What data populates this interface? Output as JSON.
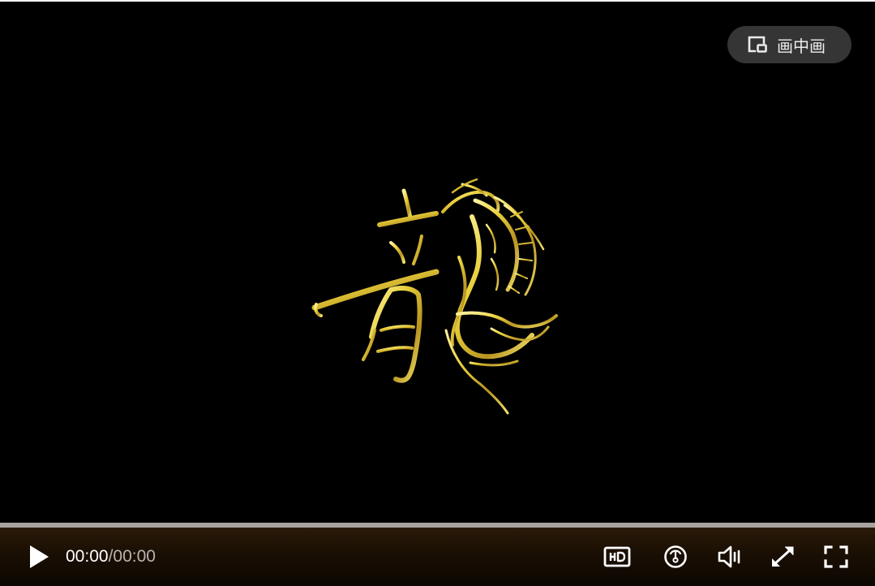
{
  "player": {
    "pip_button": {
      "label": "画中画",
      "icon": "picture-in-picture-icon"
    },
    "video_logo": {
      "description_icon": "dragon-calligraphy-logo",
      "accent_color": "#e6c93a"
    },
    "progress": {
      "played_fraction": 0.0
    },
    "controls": {
      "play_icon": "play-icon",
      "time_current": "00:00",
      "time_separator": "/",
      "time_total": "00:00",
      "hd_icon": "hd-quality-icon",
      "speed_icon": "playback-speed-icon",
      "volume_icon": "volume-icon",
      "web_fullscreen_icon": "expand-diagonal-icon",
      "fullscreen_icon": "fullscreen-icon"
    }
  }
}
